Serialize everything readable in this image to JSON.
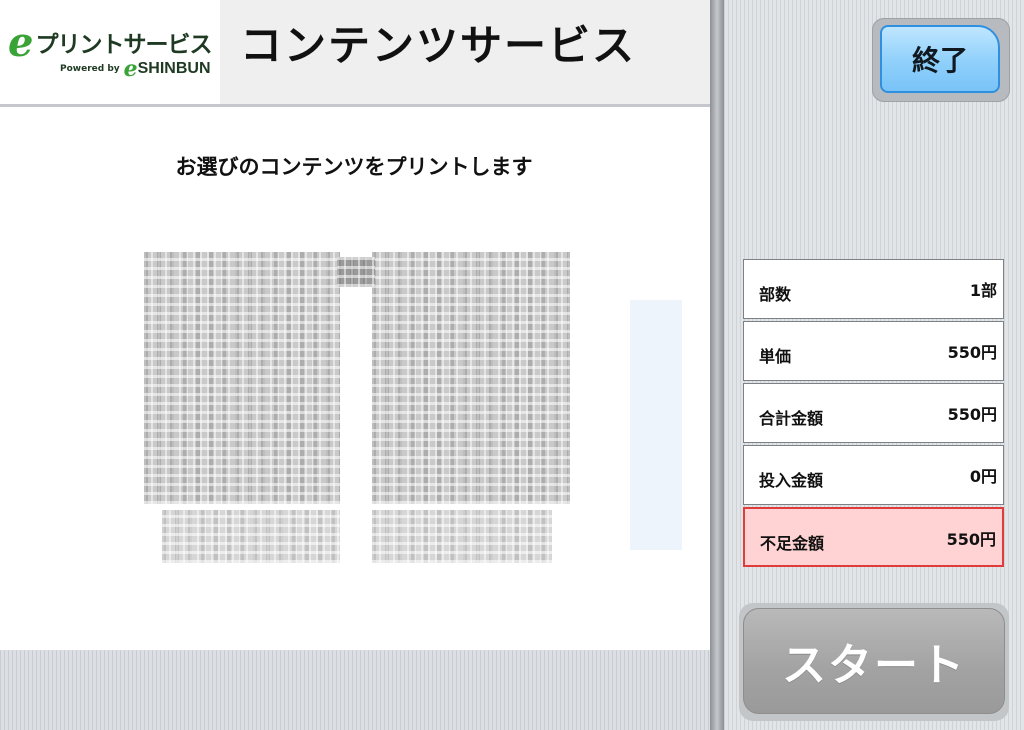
{
  "header": {
    "logo_name": "プリントサービス",
    "logo_powered": "Powered by",
    "logo_e": "e",
    "logo_shinbun": "SHINBUN",
    "title": "コンテンツサービス"
  },
  "main": {
    "instruction": "お選びのコンテンツをプリントします"
  },
  "sidebar": {
    "end_button": "終了",
    "price_rows": [
      {
        "label": "部数",
        "value": "1部"
      },
      {
        "label": "単価",
        "value": "550円"
      },
      {
        "label": "合計金額",
        "value": "550円"
      },
      {
        "label": "投入金額",
        "value": "0円"
      },
      {
        "label": "不足金額",
        "value": "550円"
      }
    ],
    "start_button": "スタート"
  },
  "colors": {
    "brand_green": "#3aa335",
    "end_button_blue": "#8fd0fb",
    "shortfall_background": "#ffd3d3",
    "shortfall_border": "#e03c3c",
    "start_button_disabled": "#a2a2a2"
  },
  "icons": {
    "logo": "eprint-logo"
  }
}
